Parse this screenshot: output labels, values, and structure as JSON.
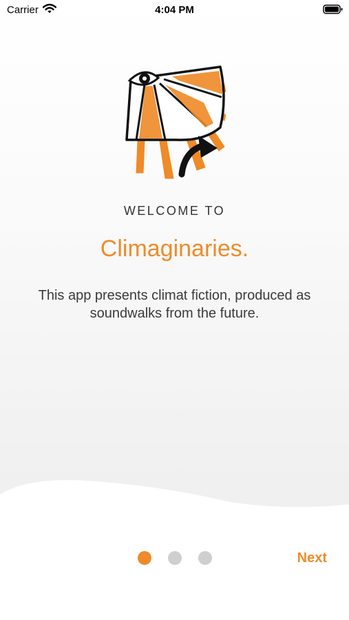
{
  "status_bar": {
    "carrier": "Carrier",
    "time": "4:04 PM",
    "icons": [
      "wifi-icon",
      "battery-icon"
    ]
  },
  "onboarding": {
    "logo_icon": "eye-fan-illustration",
    "welcome_label": "WELCOME TO",
    "app_name": "Climaginaries.",
    "description": "This app presents climat fiction, produced as soundwalks from the future.",
    "page_count": 3,
    "current_page": 1,
    "next_label": "Next"
  },
  "colors": {
    "accent": "#ee8b2a",
    "inactive_dot": "#cfcfcf",
    "text": "#3a3a3a"
  }
}
